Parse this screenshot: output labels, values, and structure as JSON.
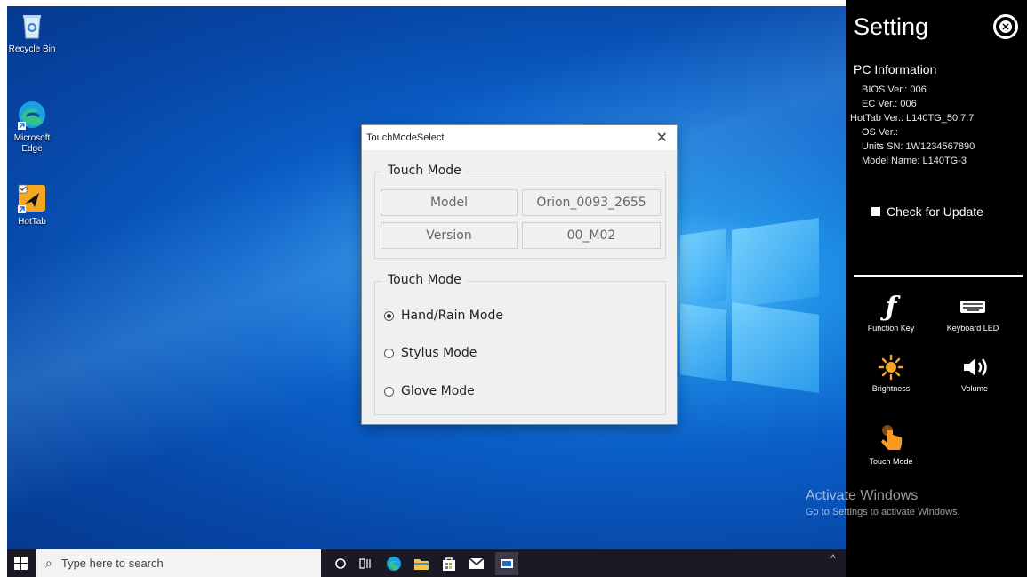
{
  "desktop": {
    "icons": [
      {
        "label": "Recycle Bin"
      },
      {
        "label": "Microsoft Edge"
      },
      {
        "label": "HotTab"
      }
    ]
  },
  "dialog": {
    "title": "TouchModeSelect",
    "close_glyph": "✕",
    "info_group_title": "Touch Mode",
    "model_label": "Model",
    "model_value": "Orion_0093_2655",
    "version_label": "Version",
    "version_value": "00_M02",
    "mode_group_title": "Touch Mode",
    "modes": [
      {
        "label": "Hand/Rain Mode",
        "selected": true
      },
      {
        "label": "Stylus Mode",
        "selected": false
      },
      {
        "label": "Glove Mode",
        "selected": false
      }
    ]
  },
  "panel": {
    "title": "Setting",
    "pc_info_title": "PC Information",
    "bios": "BIOS Ver.: 006",
    "ec": "EC Ver.: 006",
    "hottab": "HotTab Ver.: L140TG_50.7.7",
    "os": "OS Ver.:",
    "sn": "Units SN: 1W1234567890",
    "model_name": "Model Name: L140TG-3",
    "check_update": "Check for Update",
    "buttons": {
      "function_key": "Function Key",
      "keyboard_led": "Keyboard LED",
      "brightness": "Brightness",
      "volume": "Volume",
      "touch_mode": "Touch Mode"
    }
  },
  "watermark": {
    "line1": "Activate Windows",
    "line2": "Go to Settings to activate Windows."
  },
  "taskbar": {
    "search_placeholder": "Type here to search"
  },
  "colors": {
    "panel_bg": "#000000",
    "desktop_blue": "#0a5fc8",
    "taskbar_bg": "#1a1a26"
  }
}
